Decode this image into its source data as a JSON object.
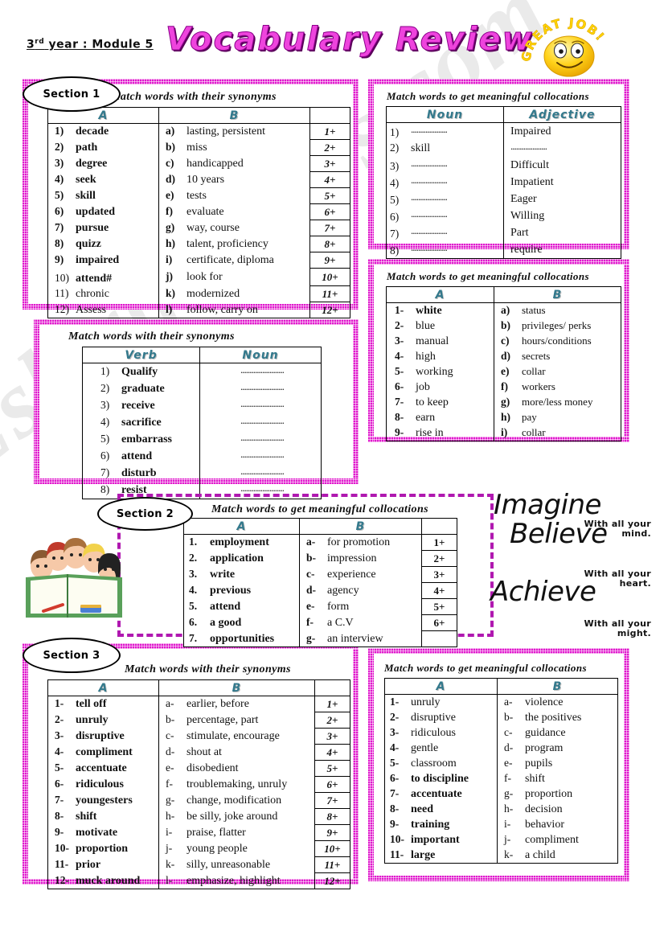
{
  "header": {
    "module_label": "3rd year  : Module 5",
    "module_sup": "rd",
    "title": "Vocabulary  Review",
    "badge_text": "GREAT JOB!"
  },
  "watermark": "Eslprintables.com",
  "sections": {
    "s1": "Section 1",
    "s2": "Section 2",
    "s3": "Section 3"
  },
  "instructions": {
    "synonyms": "Match words with their synonyms",
    "collocations": "Match words to get meaningful collocations"
  },
  "headers": {
    "A": "A",
    "B": "B",
    "noun": "Noun",
    "adjective": "Adjective",
    "verb": "Verb",
    "blank": ""
  },
  "colors": {
    "frame": "#e018cd",
    "dashed_frame": "#b018b0",
    "table_header_text": "#33798c",
    "title": "#ee44dd",
    "watermark": "#d9d9d9"
  },
  "dots_placeholder": "........................",
  "table_s1_synonyms": {
    "title": "Match words with their synonyms",
    "columns": [
      "A",
      "B",
      ""
    ],
    "rows": [
      {
        "n": "1)",
        "a": "decade",
        "l": "a)",
        "b": "lasting, persistent",
        "ans": "1+"
      },
      {
        "n": "2)",
        "a": "path",
        "l": "b)",
        "b": "miss",
        "ans": "2+"
      },
      {
        "n": "3)",
        "a": "degree",
        "l": "c)",
        "b": "handicapped",
        "ans": "3+"
      },
      {
        "n": "4)",
        "a": "seek",
        "l": "d)",
        "b": "10 years",
        "ans": "4+"
      },
      {
        "n": "5)",
        "a": "skill",
        "l": "e)",
        "b": "tests",
        "ans": "5+"
      },
      {
        "n": "6)",
        "a": "updated",
        "l": "f)",
        "b": "evaluate",
        "ans": "6+"
      },
      {
        "n": "7)",
        "a": "pursue",
        "l": "g)",
        "b": "way, course",
        "ans": "7+"
      },
      {
        "n": "8)",
        "a": "quizz",
        "l": "h)",
        "b": "talent, proficiency",
        "ans": "8+"
      },
      {
        "n": "9)",
        "a": "impaired",
        "l": "i)",
        "b": "certificate, diploma",
        "ans": "9+"
      },
      {
        "n": "10)",
        "a": "attend#",
        "l": "j)",
        "b": "look for",
        "ans": "10+"
      },
      {
        "n": "11)",
        "a": "chronic",
        "l": "k)",
        "b": "modernized",
        "ans": "11+"
      },
      {
        "n": "12)",
        "a": "Assess",
        "l": "l)",
        "b": "follow, carry on",
        "ans": "12+"
      }
    ]
  },
  "table_s1_verbnoun": {
    "title": "Match words with their synonyms",
    "columns": [
      "Verb",
      "Noun"
    ],
    "rows": [
      {
        "n": "1)",
        "verb": "Qualify",
        "noun": "........................"
      },
      {
        "n": "2)",
        "verb": "graduate",
        "noun": "........................"
      },
      {
        "n": "3)",
        "verb": "receive",
        "noun": "........................"
      },
      {
        "n": "4)",
        "verb": "sacrifice",
        "noun": "........................"
      },
      {
        "n": "5)",
        "verb": "embarrass",
        "noun": "........................"
      },
      {
        "n": "6)",
        "verb": "attend",
        "noun": "........................"
      },
      {
        "n": "7)",
        "verb": "disturb",
        "noun": "........................"
      },
      {
        "n": "8)",
        "verb": "resist",
        "noun": "........................"
      }
    ]
  },
  "table_noun_adjective": {
    "title": "Match words to get meaningful collocations",
    "columns": [
      "Noun",
      "Adjective"
    ],
    "rows": [
      {
        "n": "1)",
        "noun": "....................",
        "adj": "Impaired"
      },
      {
        "n": "2)",
        "noun": "skill",
        "adj": "...................."
      },
      {
        "n": "3)",
        "noun": "....................",
        "adj": "Difficult"
      },
      {
        "n": "4)",
        "noun": "....................",
        "adj": "Impatient"
      },
      {
        "n": "5)",
        "noun": "....................",
        "adj": "Eager"
      },
      {
        "n": "6)",
        "noun": "....................",
        "adj": "Willing"
      },
      {
        "n": "7)",
        "noun": "....................",
        "adj": "Part"
      },
      {
        "n": "8)",
        "noun": "....................",
        "adj": "require"
      }
    ]
  },
  "table_collar": {
    "title": "Match words to get meaningful collocations",
    "columns": [
      "A",
      "B"
    ],
    "rows": [
      {
        "n": "1-",
        "a": "white",
        "l": "a)",
        "b": "status"
      },
      {
        "n": "2-",
        "a": "blue",
        "l": "b)",
        "b": "privileges/ perks"
      },
      {
        "n": "3-",
        "a": "manual",
        "l": "c)",
        "b": "hours/conditions"
      },
      {
        "n": "4-",
        "a": "high",
        "l": "d)",
        "b": "secrets"
      },
      {
        "n": "5-",
        "a": "working",
        "l": "e)",
        "b": "collar"
      },
      {
        "n": "6-",
        "a": "job",
        "l": "f)",
        "b": "workers"
      },
      {
        "n": "7-",
        "a": "to keep",
        "l": "g)",
        "b": "more/less money"
      },
      {
        "n": "8-",
        "a": "earn",
        "l": "h)",
        "b": "pay"
      },
      {
        "n": "9-",
        "a": "rise in",
        "l": "i)",
        "b": "collar"
      }
    ]
  },
  "table_s2": {
    "title": "Match words to get meaningful collocations",
    "columns": [
      "A",
      "B",
      ""
    ],
    "rows": [
      {
        "n": "1.",
        "a": "employment",
        "l": "a-",
        "b": "for promotion",
        "ans": "1+"
      },
      {
        "n": "2.",
        "a": "application",
        "l": "b-",
        "b": "impression",
        "ans": "2+"
      },
      {
        "n": "3.",
        "a": "write",
        "l": "c-",
        "b": "experience",
        "ans": "3+"
      },
      {
        "n": "4.",
        "a": "previous",
        "l": "d-",
        "b": "agency",
        "ans": "4+"
      },
      {
        "n": "5.",
        "a": "attend",
        "l": "e-",
        "b": "form",
        "ans": "5+"
      },
      {
        "n": "6.",
        "a": "a good",
        "l": "f-",
        "b": "a C.V",
        "ans": "6+"
      },
      {
        "n": "7.",
        "a": "opportunities",
        "l": "g-",
        "b": "an interview",
        "ans": ""
      }
    ]
  },
  "table_s3_synonyms": {
    "title": "Match words with their synonyms",
    "columns": [
      "A",
      "B",
      ""
    ],
    "rows": [
      {
        "n": "1-",
        "a": "tell off",
        "l": "a-",
        "b": "earlier, before",
        "ans": "1+"
      },
      {
        "n": "2-",
        "a": "unruly",
        "l": "b-",
        "b": "percentage, part",
        "ans": "2+"
      },
      {
        "n": "3-",
        "a": "disruptive",
        "l": "c-",
        "b": "stimulate, encourage",
        "ans": "3+"
      },
      {
        "n": "4-",
        "a": "compliment",
        "l": "d-",
        "b": "shout at",
        "ans": "4+"
      },
      {
        "n": "5-",
        "a": "accentuate",
        "l": "e-",
        "b": "disobedient",
        "ans": "5+"
      },
      {
        "n": "6-",
        "a": "ridiculous",
        "l": "f-",
        "b": "troublemaking, unruly",
        "ans": "6+"
      },
      {
        "n": "7-",
        "a": "youngesters",
        "l": "g-",
        "b": "change, modification",
        "ans": "7+"
      },
      {
        "n": "8-",
        "a": "shift",
        "l": "h-",
        "b": "be silly, joke around",
        "ans": "8+"
      },
      {
        "n": "9-",
        "a": "motivate",
        "l": "i-",
        "b": "praise, flatter",
        "ans": "9+"
      },
      {
        "n": "10-",
        "a": "proportion",
        "l": "j-",
        "b": "young people",
        "ans": "10+"
      },
      {
        "n": "11-",
        "a": "prior",
        "l": "k-",
        "b": "silly, unreasonable",
        "ans": "11+"
      },
      {
        "n": "12-",
        "a": "muck around",
        "l": "l-",
        "b": "emphasize, highlight",
        "ans": "12+"
      }
    ]
  },
  "table_s3_collocations": {
    "title": "Match words to get meaningful collocations",
    "columns": [
      "A",
      "B"
    ],
    "rows": [
      {
        "n": "1-",
        "a": "unruly",
        "l": "a-",
        "b": "violence"
      },
      {
        "n": "2-",
        "a": "disruptive",
        "l": "b-",
        "b": "the positives"
      },
      {
        "n": "3-",
        "a": "ridiculous",
        "l": "c-",
        "b": "guidance"
      },
      {
        "n": "4-",
        "a": "gentle",
        "l": "d-",
        "b": "program"
      },
      {
        "n": "5-",
        "a": "classroom",
        "l": "e-",
        "b": "pupils"
      },
      {
        "n": "6-",
        "a": "to discipline",
        "l": "f-",
        "b": "shift"
      },
      {
        "n": "7-",
        "a": "accentuate",
        "l": "g-",
        "b": "proportion"
      },
      {
        "n": "8-",
        "a": "need",
        "l": "h-",
        "b": "decision"
      },
      {
        "n": "9-",
        "a": "training",
        "l": "i-",
        "b": "behavior"
      },
      {
        "n": "10-",
        "a": "important",
        "l": "j-",
        "b": "compliment"
      },
      {
        "n": "11-",
        "a": "large",
        "l": "k-",
        "b": "a child"
      }
    ]
  },
  "motivation": {
    "line1_big": "Imagine",
    "line1_small": "With all your mind.",
    "line2_big": "Believe",
    "line2_small": "With all your heart.",
    "line3_big": "Achieve",
    "line3_small": "With all your might."
  }
}
